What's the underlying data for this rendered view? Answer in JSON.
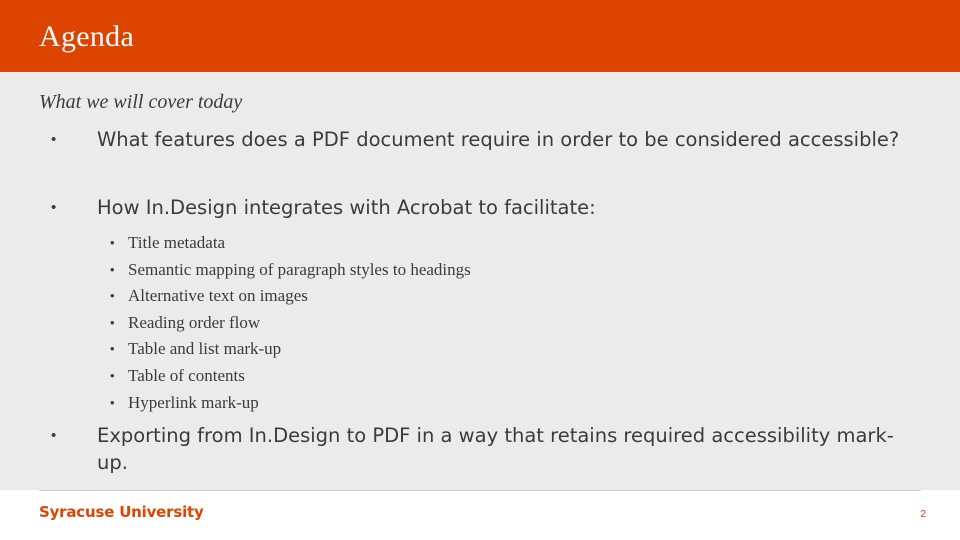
{
  "slide": {
    "title": "Agenda",
    "subtitle": "What we will cover today",
    "accent_color": "#dd4400",
    "body_background": "#ebebeb",
    "text_color": "#3b3b3b",
    "bullet_glyph": "•",
    "level1": [
      {
        "text": "What features does a PDF document require in order to be considered accessible?"
      },
      {
        "text": "How In.Design integrates with Acrobat to facilitate:"
      },
      {
        "text": "Exporting from In.Design to PDF in a way that retains required accessibility mark-up."
      }
    ],
    "level2": [
      "Title metadata",
      "Semantic mapping of paragraph styles to headings",
      "Alternative text on images",
      "Reading order flow",
      "Table and list mark-up",
      "Table of contents",
      "Hyperlink mark-up"
    ],
    "footer": {
      "logo_text": "Syracuse University",
      "page_number": "2"
    }
  }
}
